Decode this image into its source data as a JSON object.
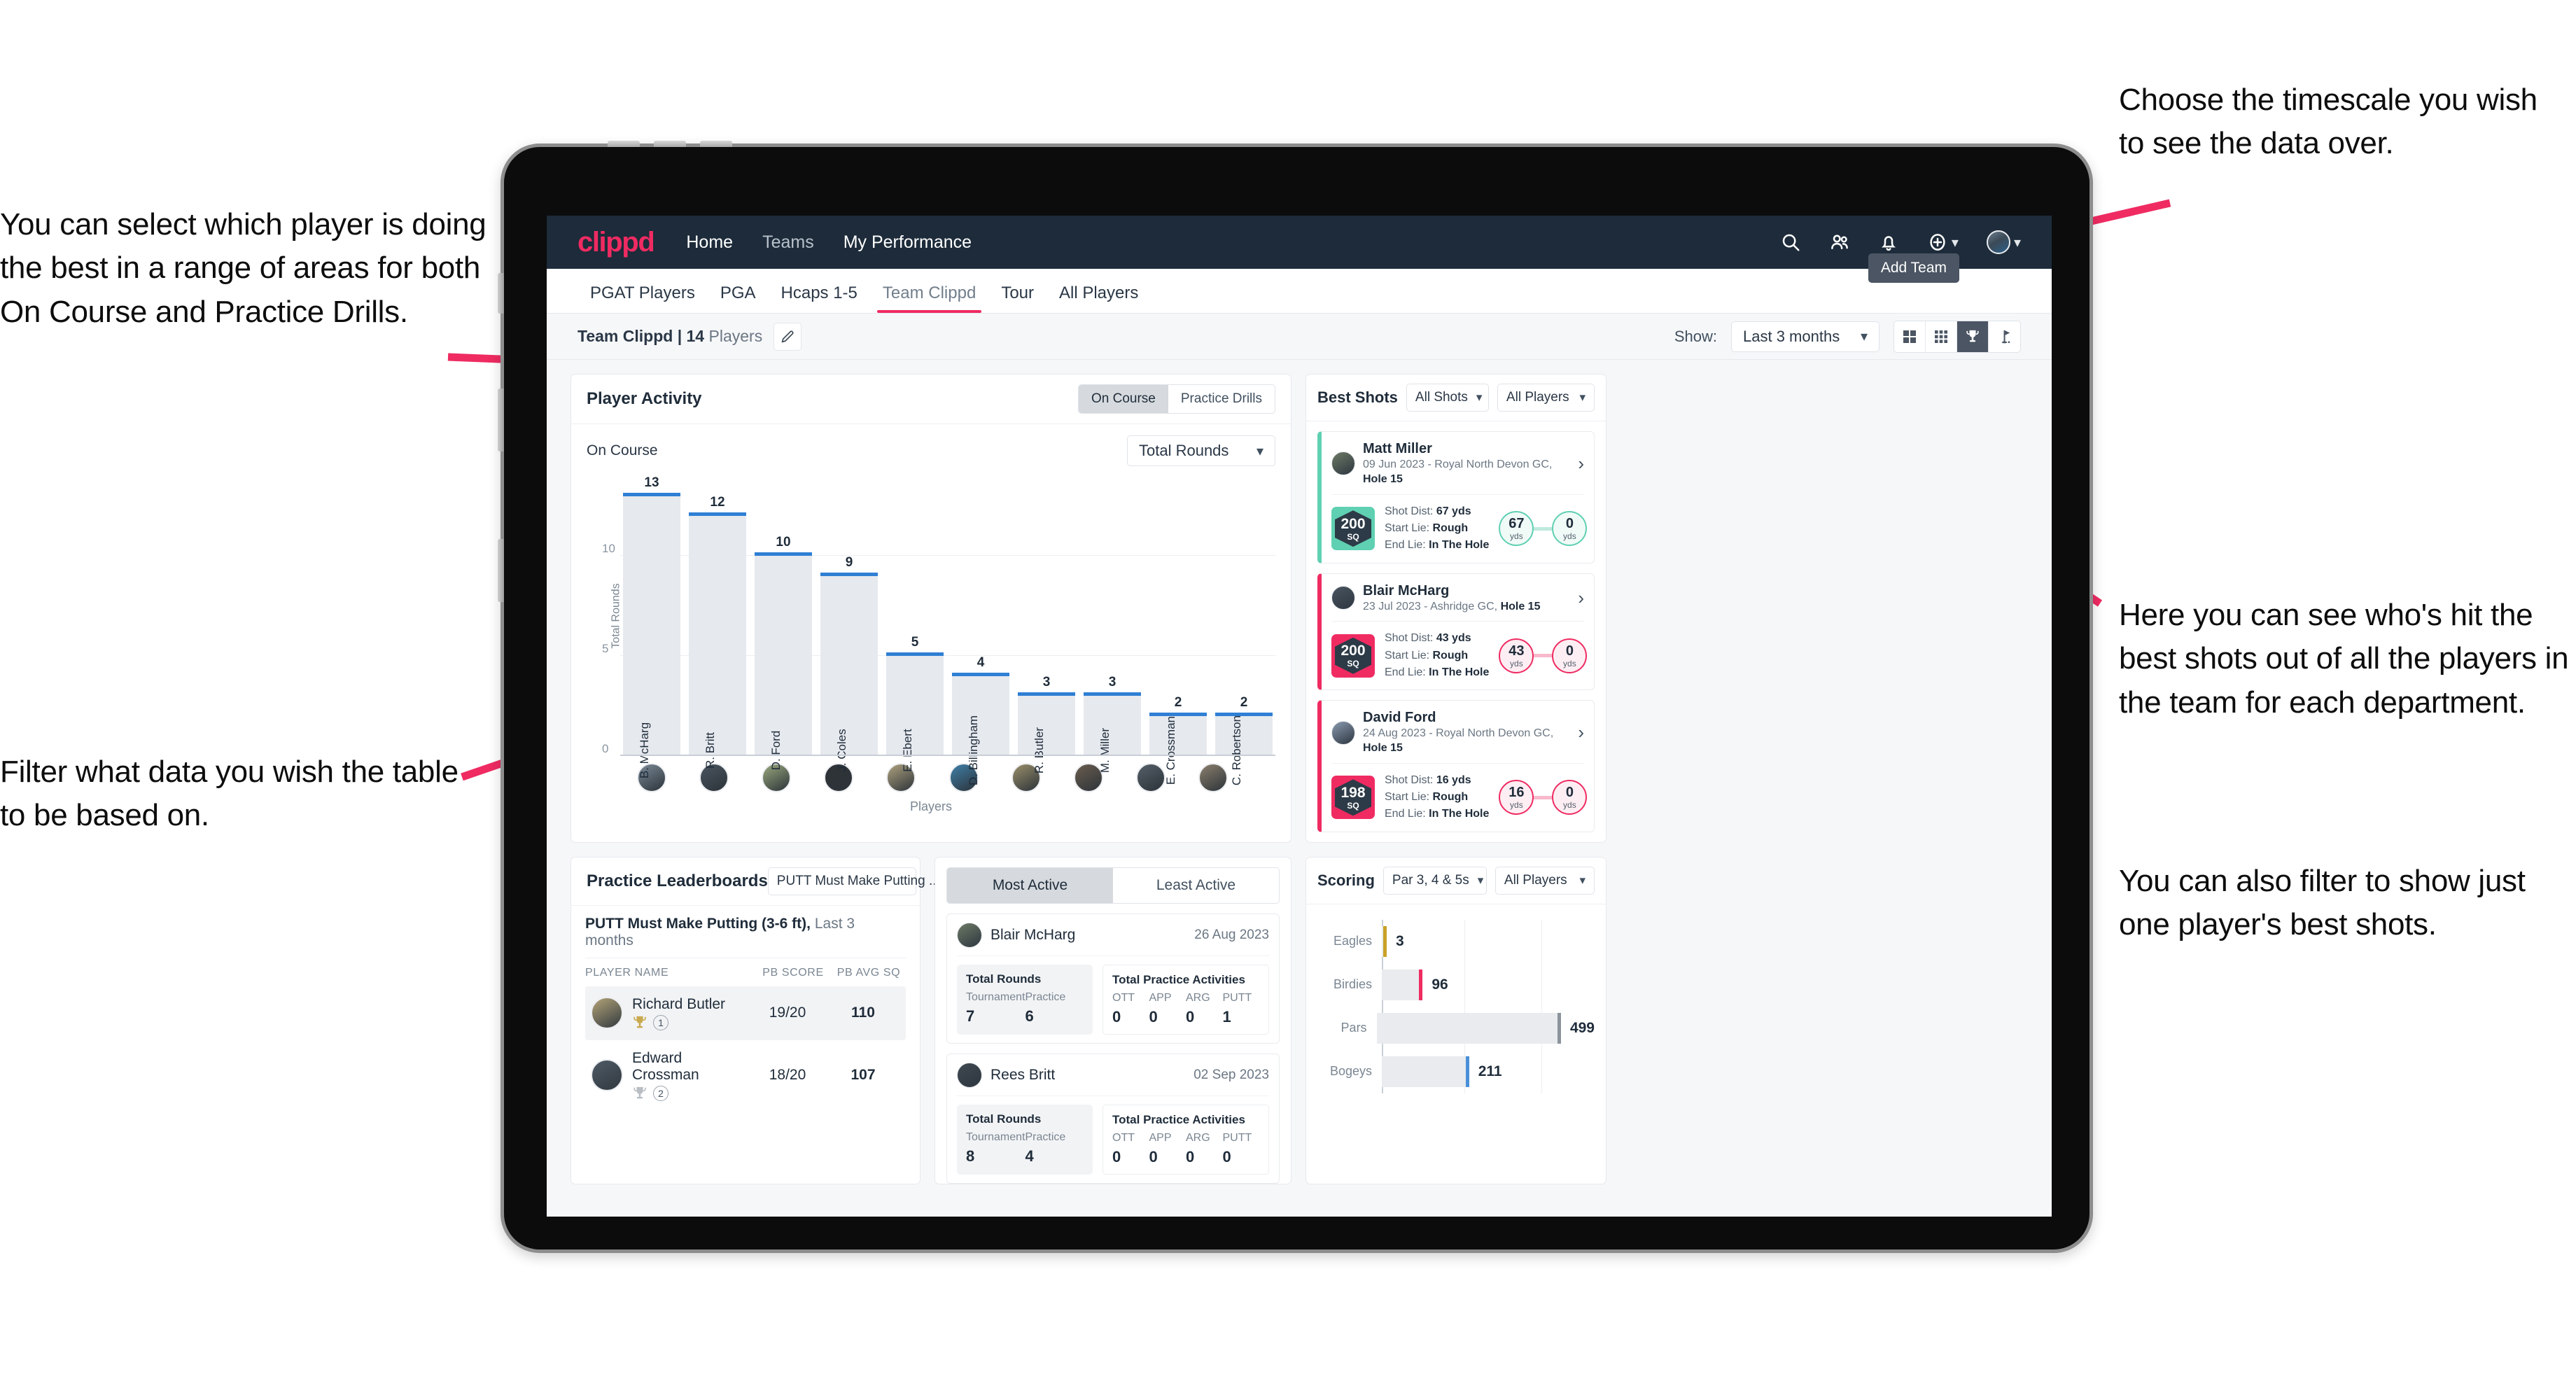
{
  "annotations": {
    "left_top": "You can select which player is doing the best in a range of areas for both On Course and Practice Drills.",
    "left_bottom": "Filter what data you wish the table to be based on.",
    "right_top": "Choose the timescale you wish to see the data over.",
    "right_mid": "Here you can see who's hit the best shots out of all the players in the team for each department.",
    "right_bottom": "You can also filter to show just one player's best shots."
  },
  "topnav": {
    "logo": "clippd",
    "links": [
      "Home",
      "Teams",
      "My Performance"
    ],
    "icons": [
      "search-icon",
      "people-icon",
      "bell-icon",
      "plus-circle-icon",
      "avatar-icon"
    ]
  },
  "tabs": {
    "items": [
      "PGAT Players",
      "PGA",
      "Hcaps 1-5",
      "Team Clippd",
      "Tour",
      "All Players"
    ],
    "active": "Team Clippd",
    "tooltip": "Add Team"
  },
  "toolbar": {
    "team_label_bold": "Team Clippd | 14",
    "team_label_muted": " Players",
    "edit_icon": "pencil-icon",
    "show_label": "Show:",
    "timescale": "Last 3 months",
    "view_buttons": [
      "grid-large-icon",
      "grid-small-icon",
      "trophy-icon",
      "flag-icon"
    ],
    "view_active_index": 2
  },
  "player_activity": {
    "title": "Player Activity",
    "segments": [
      "On Course",
      "Practice Drills"
    ],
    "segment_active": "On Course",
    "subtitle": "On Course",
    "metric_select": "Total Rounds",
    "x_axis_label": "Players"
  },
  "chart_data": {
    "type": "bar",
    "title": "Player Activity - On Course",
    "categories": [
      "B. McHarg",
      "R. Britt",
      "D. Ford",
      "J. Coles",
      "E. Ebert",
      "D. Billingham",
      "R. Butler",
      "M. Miller",
      "E. Crossman",
      "C. Robertson"
    ],
    "values": [
      13,
      12,
      10,
      9,
      5,
      4,
      3,
      3,
      2,
      2
    ],
    "xlabel": "Players",
    "ylabel": "Total Rounds",
    "ylim": [
      0,
      14
    ],
    "yticks": [
      0,
      5,
      10
    ],
    "grid": true,
    "bar_color": "#e6e9ee",
    "cap_color": "#2f7fd4"
  },
  "best_shots": {
    "title": "Best Shots",
    "shot_filter": "All Shots",
    "player_filter": "All Players",
    "shots": [
      {
        "name": "Matt Miller",
        "meta_plain": "09 Jun 2023 - Royal North Devon GC, ",
        "meta_bold": "Hole 15",
        "badge_value": "200",
        "badge_unit": "SQ",
        "accent": "teal",
        "shot_dist_label": "Shot Dist: ",
        "shot_dist": "67 yds",
        "start_lie_label": "Start Lie: ",
        "start_lie": "Rough",
        "end_lie_label": "End Lie: ",
        "end_lie": "In The Hole",
        "from_value": "67",
        "from_unit": "yds",
        "to_value": "0",
        "to_unit": "yds"
      },
      {
        "name": "Blair McHarg",
        "meta_plain": "23 Jul 2023 - Ashridge GC, ",
        "meta_bold": "Hole 15",
        "badge_value": "200",
        "badge_unit": "SQ",
        "accent": "pink",
        "shot_dist_label": "Shot Dist: ",
        "shot_dist": "43 yds",
        "start_lie_label": "Start Lie: ",
        "start_lie": "Rough",
        "end_lie_label": "End Lie: ",
        "end_lie": "In The Hole",
        "from_value": "43",
        "from_unit": "yds",
        "to_value": "0",
        "to_unit": "yds"
      },
      {
        "name": "David Ford",
        "meta_plain": "24 Aug 2023 - Royal North Devon GC, ",
        "meta_bold": "Hole 15",
        "badge_value": "198",
        "badge_unit": "SQ",
        "accent": "pink",
        "shot_dist_label": "Shot Dist: ",
        "shot_dist": "16 yds",
        "start_lie_label": "Start Lie: ",
        "start_lie": "Rough",
        "end_lie_label": "End Lie: ",
        "end_lie": "In The Hole",
        "from_value": "16",
        "from_unit": "yds",
        "to_value": "0",
        "to_unit": "yds"
      }
    ]
  },
  "practice_leaderboards": {
    "title": "Practice Leaderboards",
    "drill_select": "PUTT Must Make Putting ...",
    "subtitle_bold": "PUTT Must Make Putting (3-6 ft),",
    "subtitle_muted": " Last 3 months",
    "columns": [
      "PLAYER NAME",
      "PB SCORE",
      "PB AVG SQ"
    ],
    "rows": [
      {
        "name": "Richard Butler",
        "rank": "1",
        "trophy": "gold",
        "pb_score": "19/20",
        "pb_avg_sq": "110"
      },
      {
        "name": "Edward Crossman",
        "rank": "2",
        "trophy": "silver",
        "pb_score": "18/20",
        "pb_avg_sq": "107"
      }
    ]
  },
  "activity": {
    "tabs": [
      "Most Active",
      "Least Active"
    ],
    "active_tab": "Most Active",
    "rounds_title": "Total Rounds",
    "rounds_cols": [
      "Tournament",
      "Practice"
    ],
    "practice_title": "Total Practice Activities",
    "practice_cols": [
      "OTT",
      "APP",
      "ARG",
      "PUTT"
    ],
    "players": [
      {
        "name": "Blair McHarg",
        "date": "26 Aug 2023",
        "rounds": [
          "7",
          "6"
        ],
        "practice": [
          "0",
          "0",
          "0",
          "1"
        ]
      },
      {
        "name": "Rees Britt",
        "date": "02 Sep 2023",
        "rounds": [
          "8",
          "4"
        ],
        "practice": [
          "0",
          "0",
          "0",
          "0"
        ]
      }
    ]
  },
  "scoring": {
    "title": "Scoring",
    "par_filter": "Par 3, 4 & 5s",
    "player_filter": "All Players",
    "chart": {
      "type": "bar",
      "orientation": "horizontal",
      "categories": [
        "Eagles",
        "Birdies",
        "Pars",
        "Bogeys"
      ],
      "values": [
        3,
        96,
        499,
        211
      ],
      "xlim": [
        0,
        520
      ],
      "colors": [
        "#c9a227",
        "#ef2b62",
        "#8b939b",
        "#4a90d9"
      ]
    }
  },
  "colors": {
    "brand_pink": "#ef2b62",
    "navy": "#1d2b3a",
    "teal": "#5fd0b2",
    "bar_blue": "#2f7fd4"
  }
}
